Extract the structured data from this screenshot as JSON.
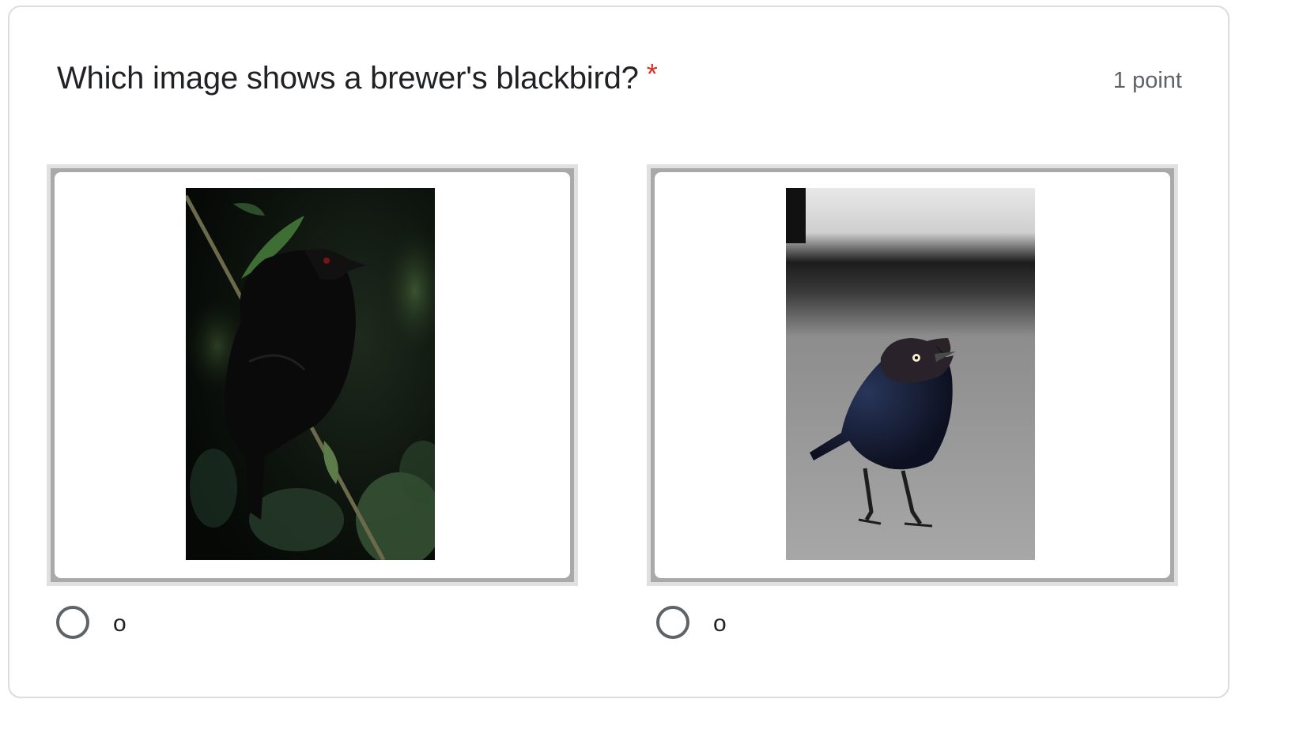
{
  "question": {
    "title": "Which image shows a brewer's blackbird?",
    "required_marker": "*",
    "points": "1 point"
  },
  "options": [
    {
      "label": "o",
      "image_subject": "black-bird-perched-on-branch-night"
    },
    {
      "label": "o",
      "image_subject": "brewers-blackbird-standing-on-pavement"
    }
  ],
  "colors": {
    "required": "#d93025",
    "text": "#202124",
    "muted": "#5f6368",
    "frame_outer": "#e0e0e0",
    "frame_inner": "#a9a9a9"
  }
}
